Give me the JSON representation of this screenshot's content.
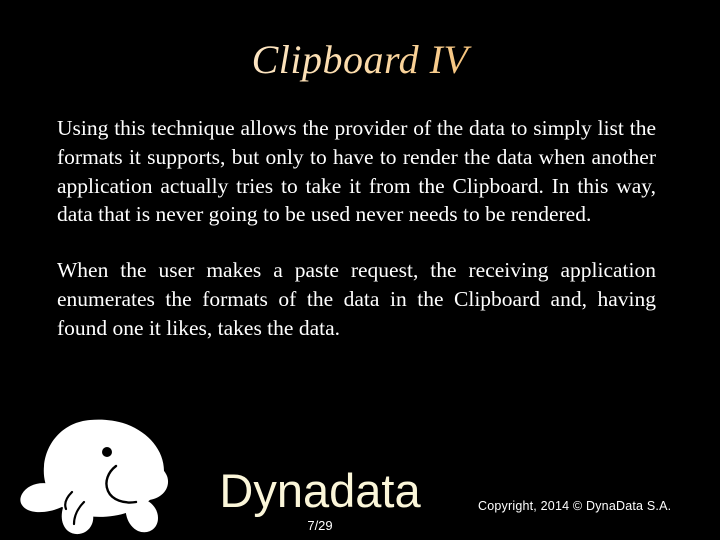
{
  "slide": {
    "background_color": "#000000",
    "title": "Clipboard IV",
    "title_gradient_start": "#d98b2b",
    "title_gradient_mid": "#fde6c4",
    "title_gradient_end": "#d8841f",
    "body_color": "#ffffff"
  },
  "content": {
    "paragraphs": [
      "Using this technique allows the provider of the data to simply list the formats it supports, but only to have to render the data when another application actually tries to take it from the Clipboard. In this way, data that is never going to be used never needs to be rendered.",
      "When the user makes a paste request, the receiving application enumerates the formats of the data in the Clipboard and, having found one it likes, takes the data."
    ]
  },
  "footer": {
    "logo_icon": "manatee-logo-icon",
    "logo_color": "#ffffff",
    "brand_name": "Dynadata",
    "brand_color": "#fbf6d9",
    "page_number": "7/29",
    "copyright": "Copyright, 2014 © DynaData S.A."
  }
}
